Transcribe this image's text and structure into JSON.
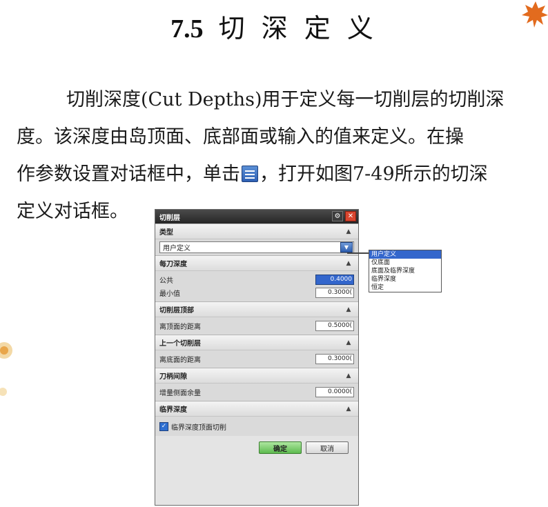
{
  "slide": {
    "section_number": "7.5",
    "section_title": "切 深 定 义",
    "paragraph": {
      "line1": "切削深度(Cut Depths)用于定义每一切削层的切削深",
      "line2": "度。该深度由岛顶面、底部面或输入的值来定义。在操",
      "line3a": "作参数设置对话框中，单击",
      "line3b": "，打开如图7-49所示的切深",
      "line4": "定义对话框。"
    }
  },
  "dialog": {
    "title": "切削层",
    "sections": {
      "type": {
        "header": "类型",
        "selected": "用户定义"
      },
      "per_cut": {
        "header": "每刀深度",
        "common_label": "公共",
        "common_value": "0.4000",
        "min_label": "最小值",
        "min_value": "0.3000("
      },
      "cut_top": {
        "header": "切削层顶部",
        "label": "离顶面的距离",
        "value": "0.5000("
      },
      "prev_layer": {
        "header": "上一个切削层",
        "label": "离底面的距离",
        "value": "0.3000("
      },
      "shank": {
        "header": "刀柄间隙",
        "label": "增量侧面余量",
        "value": "0.0000("
      },
      "critical": {
        "header": "临界深度",
        "checkbox_label": "临界深度顶面切削",
        "checked": true
      }
    },
    "buttons": {
      "ok": "确定",
      "cancel": "取消"
    },
    "dropdown_options": [
      "用户定义",
      "仅底面",
      "底面及临界深度",
      "临界深度",
      "恒定"
    ]
  },
  "colors": {
    "accent": "#3366cc",
    "ok_button": "#5ebb4f",
    "title_bar": "#262626"
  }
}
